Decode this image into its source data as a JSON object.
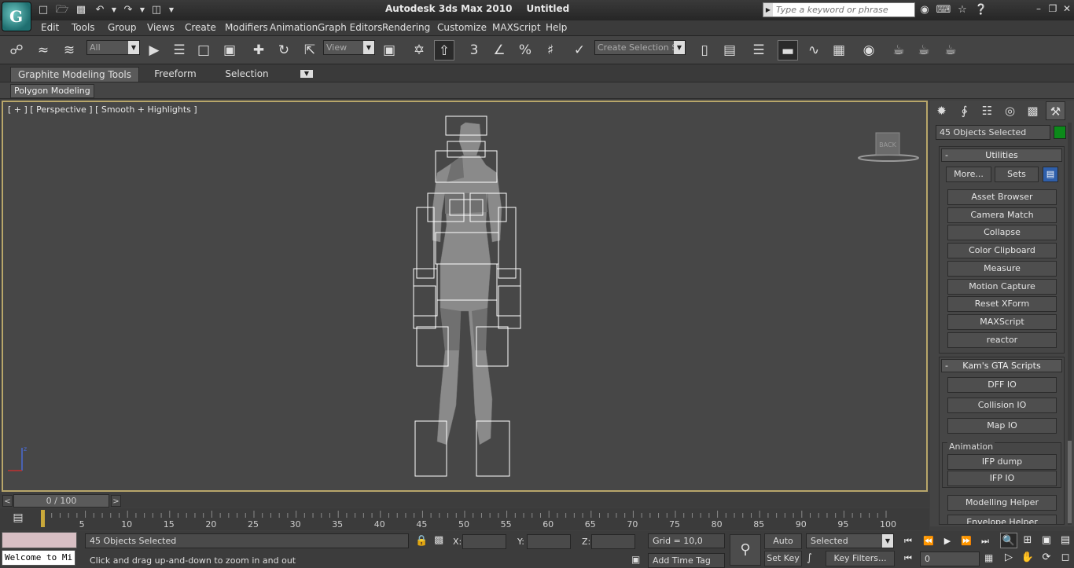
{
  "title_bar": {
    "app_name": "Autodesk 3ds Max 2010",
    "document_name": "Untitled",
    "search_placeholder": "Type a keyword or phrase",
    "quick_access_icons": [
      "new-file-icon",
      "open-file-icon",
      "save-icon",
      "undo-icon",
      "redo-icon",
      "project-folder-icon"
    ],
    "info_icons": [
      "binoculars-icon",
      "key-icon",
      "star-icon",
      "help-icon"
    ]
  },
  "menu": [
    "Edit",
    "Tools",
    "Group",
    "Views",
    "Create",
    "Modifiers",
    "Animation",
    "Graph Editors",
    "Rendering",
    "Customize",
    "MAXScript",
    "Help"
  ],
  "toolbar": {
    "selection_filter": "All",
    "reference_coord": "View",
    "named_selection": "Create Selection Se",
    "snap_label": "3",
    "percent_snap_label": "%"
  },
  "ribbon": {
    "tabs": [
      "Graphite Modeling Tools",
      "Freeform",
      "Selection"
    ],
    "panel_label": "Polygon Modeling"
  },
  "viewport": {
    "label": "[ + ] [ Perspective ] [ Smooth + Highlights ]",
    "viewcube_face": "BACK",
    "axis_z": "z"
  },
  "timeline": {
    "frame_counter": "0 / 100",
    "ticks": [
      "5",
      "10",
      "15",
      "20",
      "25",
      "30",
      "35",
      "40",
      "45",
      "50",
      "55",
      "60",
      "65",
      "70",
      "75",
      "80",
      "85",
      "90",
      "95",
      "100"
    ]
  },
  "status": {
    "maxscript_listener": "Welcome to Mi",
    "selection_info": "45 Objects Selected",
    "prompt": "Click and drag up-and-down to zoom in and out",
    "x_label": "X:",
    "y_label": "Y:",
    "z_label": "Z:",
    "grid": "Grid = 10,0",
    "add_time_tag": "Add Time Tag",
    "auto_key": "Auto Key",
    "set_key": "Set Key",
    "key_mode": "Selected",
    "key_filters": "Key Filters...",
    "current_frame": "0"
  },
  "command_panel": {
    "selection_name": "45 Objects Selected",
    "selection_color": "#0c8a1a",
    "utilities": {
      "title": "Utilities",
      "more_label": "More...",
      "sets_label": "Sets",
      "buttons": [
        "Asset Browser",
        "Camera Match",
        "Collapse",
        "Color Clipboard",
        "Measure",
        "Motion Capture",
        "Reset XForm",
        "MAXScript",
        "reactor"
      ]
    },
    "kams": {
      "title": "Kam's GTA Scripts",
      "buttons": [
        "DFF IO",
        "Collision IO",
        "Map IO"
      ],
      "animation_group": "Animation",
      "animation_buttons": [
        "IFP dump",
        "IFP IO"
      ],
      "extra_buttons": [
        "Modelling Helper",
        "Envelope Helper"
      ]
    }
  }
}
